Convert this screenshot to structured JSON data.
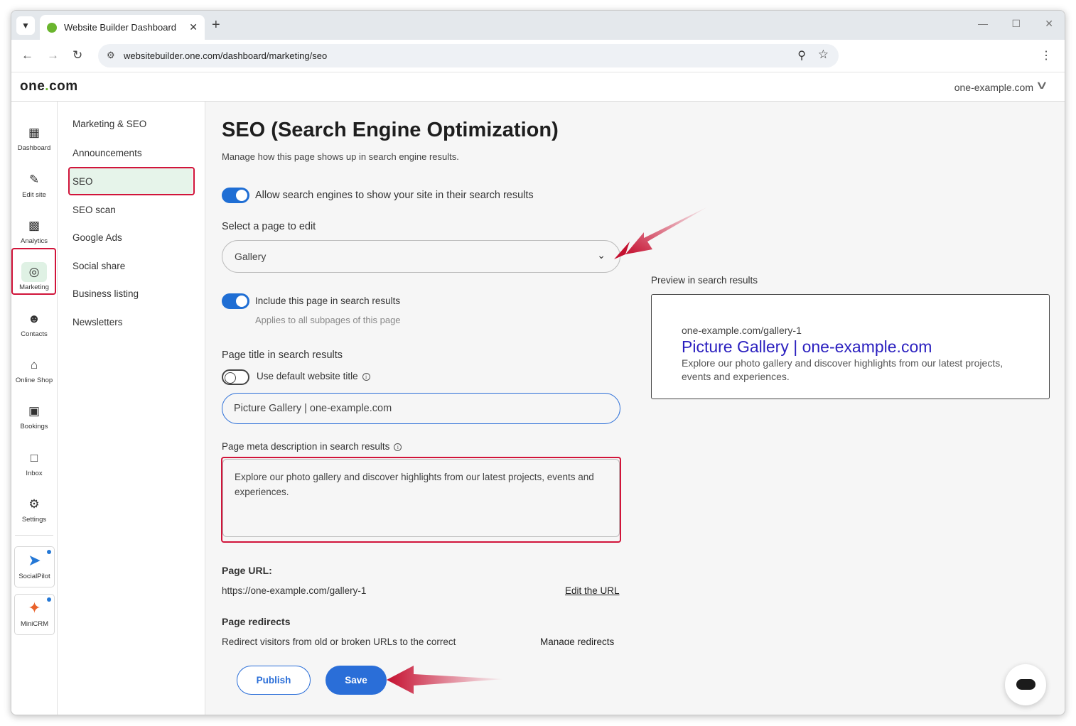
{
  "browser": {
    "tab_title": "Website Builder Dashboard",
    "url": "websitebuilder.one.com/dashboard/marketing/seo"
  },
  "header": {
    "logo": "one.com",
    "logo_parts": [
      "one",
      ".",
      "com"
    ],
    "domain": "one-example.com"
  },
  "rail": {
    "items": [
      {
        "label": "Dashboard",
        "icon": "dashboard-icon"
      },
      {
        "label": "Edit site",
        "icon": "edit-site-icon"
      },
      {
        "label": "Analytics",
        "icon": "analytics-icon"
      },
      {
        "label": "Marketing",
        "icon": "target-icon"
      },
      {
        "label": "Contacts",
        "icon": "contacts-icon"
      },
      {
        "label": "Online Shop",
        "icon": "shop-icon"
      },
      {
        "label": "Bookings",
        "icon": "calendar-icon"
      },
      {
        "label": "Inbox",
        "icon": "inbox-icon"
      },
      {
        "label": "Settings",
        "icon": "gear-icon"
      }
    ],
    "apps": [
      {
        "label": "SocialPilot",
        "icon": "socialpilot-icon"
      },
      {
        "label": "MiniCRM",
        "icon": "minicrm-icon"
      }
    ]
  },
  "subnav": {
    "heading": "Marketing & SEO",
    "items": [
      "Announcements",
      "SEO",
      "SEO scan",
      "Google Ads",
      "Social share",
      "Business listing",
      "Newsletters"
    ],
    "selected": "SEO"
  },
  "main": {
    "title": "SEO (Search Engine Optimization)",
    "subtitle": "Manage how this page shows up in search engine results.",
    "allow_toggle_label": "Allow search engines to show your site in their search results",
    "select_label": "Select a page to edit",
    "select_value": "Gallery",
    "include_toggle_label": "Include this page in search results",
    "include_toggle_hint": "Applies to all subpages of this page",
    "title_label": "Page title in search results",
    "default_title_label": "Use default website title",
    "title_value": "Picture Gallery | one-example.com",
    "meta_label": "Page meta description in search results",
    "meta_value": "Explore our photo gallery and discover highlights from our latest projects, events and experiences.",
    "url_label": "Page URL:",
    "url_value": "https://one-example.com/gallery-1",
    "edit_url_link": "Edit the URL",
    "redirects_label": "Page redirects",
    "redirects_text": "Redirect visitors from old or broken URLs to the correct",
    "manage_redirects_link": "Manage redirects"
  },
  "preview": {
    "label": "Preview in search results",
    "url": "one-example.com/gallery-1",
    "title": "Picture Gallery | one-example.com",
    "description": "Explore our photo gallery and discover highlights from our latest projects, events and experiences."
  },
  "actions": {
    "publish": "Publish",
    "save": "Save"
  },
  "colors": {
    "accent": "#2a6ed8",
    "brand_green": "#6ab52e",
    "highlight": "#d1143a",
    "preview_title": "#2a1fbf"
  }
}
